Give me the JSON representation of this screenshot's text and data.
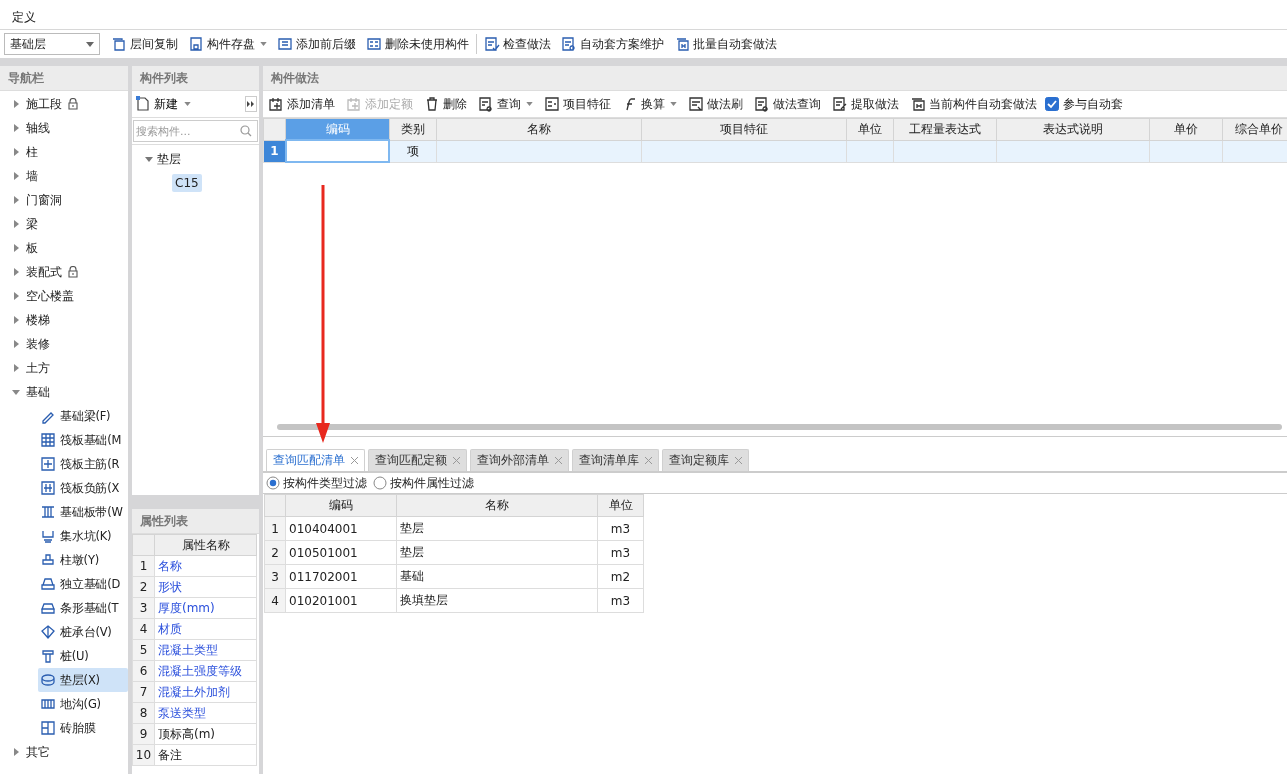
{
  "menu": [
    "定义"
  ],
  "toolbar": {
    "floor_select": "基础层",
    "buttons": [
      {
        "label": "层间复制",
        "dropdown": false
      },
      {
        "label": "构件存盘",
        "dropdown": true
      },
      {
        "label": "添加前后缀",
        "dropdown": false
      },
      {
        "label": "删除未使用构件",
        "dropdown": false
      },
      {
        "label": "检查做法",
        "dropdown": false
      },
      {
        "label": "自动套方案维护",
        "dropdown": false
      },
      {
        "label": "批量自动套做法",
        "dropdown": false
      }
    ]
  },
  "nav": {
    "title": "导航栏",
    "items": [
      {
        "label": "施工段",
        "locked": true,
        "expanded": false
      },
      {
        "label": "轴线",
        "locked": false,
        "expanded": false
      },
      {
        "label": "柱",
        "locked": false,
        "expanded": false
      },
      {
        "label": "墙",
        "locked": false,
        "expanded": false
      },
      {
        "label": "门窗洞",
        "locked": false,
        "expanded": false
      },
      {
        "label": "梁",
        "locked": false,
        "expanded": false
      },
      {
        "label": "板",
        "locked": false,
        "expanded": false
      },
      {
        "label": "装配式",
        "locked": true,
        "expanded": false
      },
      {
        "label": "空心楼盖",
        "locked": false,
        "expanded": false
      },
      {
        "label": "楼梯",
        "locked": false,
        "expanded": false
      },
      {
        "label": "装修",
        "locked": false,
        "expanded": false
      },
      {
        "label": "土方",
        "locked": false,
        "expanded": false
      },
      {
        "label": "基础",
        "locked": false,
        "expanded": true,
        "children": [
          {
            "label": "基础梁(F)",
            "selected": false
          },
          {
            "label": "筏板基础(M",
            "selected": false
          },
          {
            "label": "筏板主筋(R",
            "selected": false
          },
          {
            "label": "筏板负筋(X",
            "selected": false
          },
          {
            "label": "基础板带(W",
            "selected": false
          },
          {
            "label": "集水坑(K)",
            "selected": false
          },
          {
            "label": "柱墩(Y)",
            "selected": false
          },
          {
            "label": "独立基础(D",
            "selected": false
          },
          {
            "label": "条形基础(T",
            "selected": false
          },
          {
            "label": "桩承台(V)",
            "selected": false
          },
          {
            "label": "桩(U)",
            "selected": false
          },
          {
            "label": "垫层(X)",
            "selected": true
          },
          {
            "label": "地沟(G)",
            "selected": false
          },
          {
            "label": "砖胎膜",
            "selected": false
          }
        ]
      },
      {
        "label": "其它",
        "locked": false,
        "expanded": false
      }
    ]
  },
  "component_list": {
    "title": "构件列表",
    "new_button": "新建",
    "search_placeholder": "搜索构件...",
    "tree": [
      {
        "label": "垫层",
        "expanded": true,
        "children": [
          {
            "label": "C15",
            "selected": true
          }
        ]
      }
    ]
  },
  "property_list": {
    "title": "属性列表",
    "column": "属性名称",
    "rows": [
      {
        "index": "1",
        "name": "名称",
        "kind": "link"
      },
      {
        "index": "2",
        "name": "形状",
        "kind": "link"
      },
      {
        "index": "3",
        "name": "厚度(mm)",
        "kind": "link"
      },
      {
        "index": "4",
        "name": "材质",
        "kind": "link"
      },
      {
        "index": "5",
        "name": "混凝土类型",
        "kind": "link"
      },
      {
        "index": "6",
        "name": "混凝土强度等级",
        "kind": "link"
      },
      {
        "index": "7",
        "name": "混凝土外加剂",
        "kind": "link"
      },
      {
        "index": "8",
        "name": "泵送类型",
        "kind": "link"
      },
      {
        "index": "9",
        "name": "顶标高(m)",
        "kind": "plain"
      },
      {
        "index": "10",
        "name": "备注",
        "kind": "plain"
      }
    ]
  },
  "method": {
    "title": "构件做法",
    "toolbar": [
      {
        "label": "添加清单",
        "kind": "button",
        "disabled": false,
        "dropdown": false
      },
      {
        "label": "添加定额",
        "kind": "button",
        "disabled": true,
        "dropdown": false
      },
      {
        "label": "删除",
        "kind": "button",
        "disabled": false,
        "dropdown": false
      },
      {
        "label": "查询",
        "kind": "button",
        "disabled": false,
        "dropdown": true
      },
      {
        "label": "项目特征",
        "kind": "button",
        "disabled": false,
        "dropdown": false
      },
      {
        "label": "换算",
        "kind": "button",
        "disabled": false,
        "dropdown": true
      },
      {
        "label": "做法刷",
        "kind": "button",
        "disabled": false,
        "dropdown": false
      },
      {
        "label": "做法查询",
        "kind": "button",
        "disabled": false,
        "dropdown": false
      },
      {
        "label": "提取做法",
        "kind": "button",
        "disabled": false,
        "dropdown": false
      },
      {
        "label": "当前构件自动套做法",
        "kind": "button",
        "disabled": false,
        "dropdown": false
      },
      {
        "label": "参与自动套",
        "kind": "checkbox",
        "checked": true
      }
    ],
    "table": {
      "columns": [
        {
          "label": "编码",
          "selected": true
        },
        {
          "label": "类别",
          "selected": false
        },
        {
          "label": "名称",
          "selected": false
        },
        {
          "label": "项目特征",
          "selected": false
        },
        {
          "label": "单位",
          "selected": false
        },
        {
          "label": "工程量表达式",
          "selected": false
        },
        {
          "label": "表达式说明",
          "selected": false
        },
        {
          "label": "单价",
          "selected": false
        },
        {
          "label": "综合单价",
          "selected": false
        }
      ],
      "rows": [
        {
          "index": "1",
          "category": "项",
          "selected": true
        }
      ]
    }
  },
  "query": {
    "tabs": [
      {
        "label": "查询匹配清单",
        "selected": true
      },
      {
        "label": "查询匹配定额",
        "selected": false
      },
      {
        "label": "查询外部清单",
        "selected": false
      },
      {
        "label": "查询清单库",
        "selected": false
      },
      {
        "label": "查询定额库",
        "selected": false
      }
    ],
    "filters": [
      {
        "label": "按构件类型过滤",
        "selected": true
      },
      {
        "label": "按构件属性过滤",
        "selected": false
      }
    ],
    "table": {
      "columns": [
        "编码",
        "名称",
        "单位"
      ],
      "rows": [
        {
          "index": "1",
          "code": "010404001",
          "name": "垫层",
          "unit": "m3"
        },
        {
          "index": "2",
          "code": "010501001",
          "name": "垫层",
          "unit": "m3"
        },
        {
          "index": "3",
          "code": "011702001",
          "name": "基础",
          "unit": "m2"
        },
        {
          "index": "4",
          "code": "010201001",
          "name": "换填垫层",
          "unit": "m3"
        }
      ]
    }
  }
}
